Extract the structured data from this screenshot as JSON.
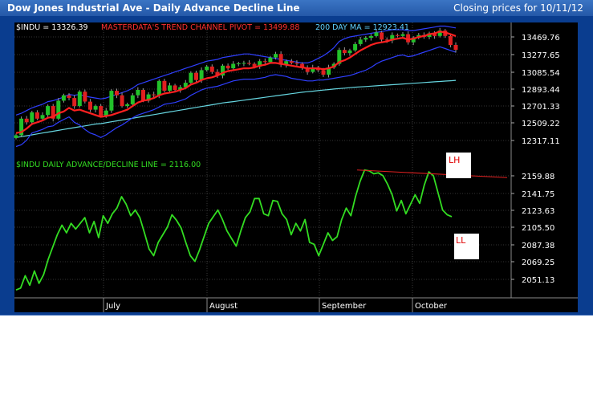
{
  "header": {
    "title": "Dow Jones Industrial Ave - Daily Advance Decline Line",
    "date_text": "Closing prices for 10/11/12"
  },
  "legend": {
    "price": "$INDU = 13326.39",
    "pivot": "MASTERDATA'S TREND CHANNEL PIVOT = 13499.88",
    "ma": "200 DAY MA = 12923.41",
    "ad": "$INDU DAILY ADVANCE/DECLINE LINE = 2116.00"
  },
  "annotations": {
    "lh": "LH",
    "ll": "LL"
  },
  "colors": {
    "background": "#000000",
    "frame": "#0a3d8f",
    "up_candle": "#22c22a",
    "down_candle": "#e02020",
    "pivot_line": "#ff2020",
    "channel_line": "#2f3fff",
    "ma_line": "#66d6e0",
    "ad_line": "#33dd22",
    "legend_price": "#ffffff",
    "legend_pivot": "#ff3030",
    "legend_ma": "#5fd0ff",
    "legend_ad": "#33dd22"
  },
  "chart_data": [
    {
      "type": "candlestick",
      "title": "Dow Jones Industrial Ave",
      "x_labels": [
        "July",
        "August",
        "September",
        "October"
      ],
      "y_ticks": [
        "13469.76",
        "13277.65",
        "13085.54",
        "12893.44",
        "12701.33",
        "12509.22",
        "12317.11"
      ],
      "ylim": [
        12250,
        13600
      ],
      "close": [
        12375,
        12560,
        12520,
        12630,
        12560,
        12600,
        12700,
        12560,
        12760,
        12820,
        12790,
        12700,
        12860,
        12750,
        12660,
        12700,
        12590,
        12650,
        12870,
        12820,
        12700,
        12720,
        12820,
        12880,
        12760,
        12830,
        12820,
        12980,
        12870,
        12930,
        12880,
        12910,
        12960,
        13070,
        12990,
        13100,
        13140,
        13080,
        13040,
        13150,
        13120,
        13170,
        13175,
        13180,
        13170,
        13140,
        13200,
        13190,
        13240,
        13280,
        13160,
        13200,
        13180,
        13170,
        13130,
        13080,
        13130,
        13100,
        13050,
        13130,
        13170,
        13325,
        13290,
        13320,
        13390,
        13440,
        13460,
        13480,
        13520,
        13440,
        13430,
        13490,
        13480,
        13500,
        13410,
        13460,
        13490,
        13470,
        13510,
        13480,
        13540,
        13480,
        13380,
        13326
      ],
      "series": [
        {
          "name": "MASTERDATA'S TREND CHANNEL PIVOT",
          "values": [
            12400,
            12410,
            12450,
            12500,
            12520,
            12540,
            12570,
            12580,
            12620,
            12640,
            12680,
            12650,
            12660,
            12640,
            12620,
            12600,
            12580,
            12590,
            12600,
            12620,
            12640,
            12660,
            12700,
            12740,
            12760,
            12770,
            12790,
            12820,
            12840,
            12850,
            12860,
            12880,
            12900,
            12940,
            12960,
            12990,
            13010,
            13020,
            13040,
            13070,
            13090,
            13100,
            13110,
            13120,
            13120,
            13130,
            13150,
            13160,
            13180,
            13180,
            13170,
            13160,
            13150,
            13140,
            13130,
            13120,
            13120,
            13120,
            13110,
            13120,
            13140,
            13190,
            13210,
            13240,
            13280,
            13320,
            13350,
            13380,
            13400,
            13410,
            13420,
            13440,
            13450,
            13460,
            13440,
            13450,
            13470,
            13480,
            13500,
            13510,
            13530,
            13520,
            13500,
            13480
          ]
        },
        {
          "name": "Trend channel upper",
          "values": [
            12600,
            12620,
            12650,
            12680,
            12700,
            12720,
            12750,
            12760,
            12780,
            12800,
            12830,
            12820,
            12830,
            12810,
            12800,
            12790,
            12780,
            12790,
            12810,
            12830,
            12850,
            12870,
            12900,
            12940,
            12960,
            12980,
            13000,
            13020,
            13040,
            13060,
            13080,
            13100,
            13120,
            13140,
            13160,
            13180,
            13200,
            13210,
            13220,
            13240,
            13250,
            13260,
            13270,
            13280,
            13280,
            13270,
            13260,
            13250,
            13240,
            13230,
            13220,
            13210,
            13200,
            13190,
            13180,
            13180,
            13200,
            13230,
            13260,
            13300,
            13350,
            13420,
            13450,
            13470,
            13480,
            13490,
            13500,
            13510,
            13520,
            13530,
            13540,
            13550,
            13550,
            13550,
            13540,
            13540,
            13550,
            13560,
            13570,
            13580,
            13590,
            13590,
            13580,
            13570
          ]
        },
        {
          "name": "Trend channel lower",
          "values": [
            12250,
            12270,
            12320,
            12400,
            12420,
            12440,
            12470,
            12480,
            12520,
            12550,
            12580,
            12520,
            12490,
            12440,
            12400,
            12380,
            12350,
            12380,
            12420,
            12460,
            12490,
            12530,
            12570,
            12600,
            12620,
            12640,
            12660,
            12690,
            12720,
            12730,
            12740,
            12760,
            12780,
            12820,
            12850,
            12880,
            12900,
            12910,
            12920,
            12940,
            12960,
            12980,
            12990,
            13000,
            13000,
            13000,
            13010,
            13020,
            13040,
            13050,
            13040,
            13030,
            13010,
            13000,
            12990,
            12980,
            12980,
            12990,
            12990,
            13000,
            13010,
            13020,
            13030,
            13040,
            13060,
            13080,
            13100,
            13130,
            13170,
            13200,
            13220,
            13240,
            13260,
            13270,
            13250,
            13260,
            13280,
            13300,
            13320,
            13340,
            13360,
            13340,
            13320,
            13300
          ]
        },
        {
          "name": "200 DAY MA",
          "values": [
            12350,
            12360,
            12370,
            12380,
            12390,
            12400,
            12410,
            12420,
            12430,
            12440,
            12450,
            12460,
            12470,
            12480,
            12490,
            12500,
            12505,
            12515,
            12525,
            12535,
            12545,
            12555,
            12565,
            12575,
            12585,
            12595,
            12605,
            12615,
            12625,
            12635,
            12645,
            12655,
            12665,
            12675,
            12685,
            12695,
            12705,
            12715,
            12725,
            12735,
            12742,
            12750,
            12758,
            12766,
            12774,
            12782,
            12790,
            12798,
            12806,
            12814,
            12822,
            12830,
            12838,
            12846,
            12854,
            12860,
            12866,
            12872,
            12878,
            12884,
            12890,
            12895,
            12900,
            12905,
            12910,
            12914,
            12918,
            12922,
            12926,
            12930,
            12934,
            12938,
            12942,
            12946,
            12950,
            12954,
            12958,
            12962,
            12966,
            12970,
            12974,
            12978,
            12982,
            12986
          ]
        }
      ]
    },
    {
      "type": "line",
      "title": "$INDU DAILY ADVANCE/DECLINE LINE",
      "y_ticks": [
        "2159.88",
        "2141.75",
        "2123.63",
        "2105.50",
        "2087.38",
        "2069.25",
        "2051.13"
      ],
      "ylim": [
        2035,
        2178
      ],
      "values": [
        2040,
        2042,
        2055,
        2045,
        2060,
        2047,
        2056,
        2072,
        2085,
        2098,
        2108,
        2100,
        2110,
        2104,
        2110,
        2116,
        2100,
        2112,
        2095,
        2118,
        2110,
        2120,
        2126,
        2138,
        2130,
        2118,
        2124,
        2116,
        2100,
        2083,
        2076,
        2090,
        2098,
        2106,
        2119,
        2113,
        2105,
        2090,
        2076,
        2070,
        2082,
        2096,
        2110,
        2117,
        2124,
        2114,
        2102,
        2094,
        2086,
        2102,
        2116,
        2122,
        2136,
        2136,
        2120,
        2118,
        2134,
        2133,
        2120,
        2114,
        2098,
        2110,
        2102,
        2114,
        2090,
        2088,
        2076,
        2088,
        2100,
        2092,
        2096,
        2114,
        2126,
        2118,
        2138,
        2154,
        2166,
        2165,
        2162,
        2163,
        2160,
        2151,
        2140,
        2123,
        2134,
        2120,
        2130,
        2140,
        2131,
        2150,
        2164,
        2160,
        2142,
        2124,
        2119,
        2117
      ],
      "resistance_line": {
        "from": [
          2166,
          "Sep"
        ],
        "to": [
          2162,
          "Oct"
        ]
      }
    }
  ]
}
